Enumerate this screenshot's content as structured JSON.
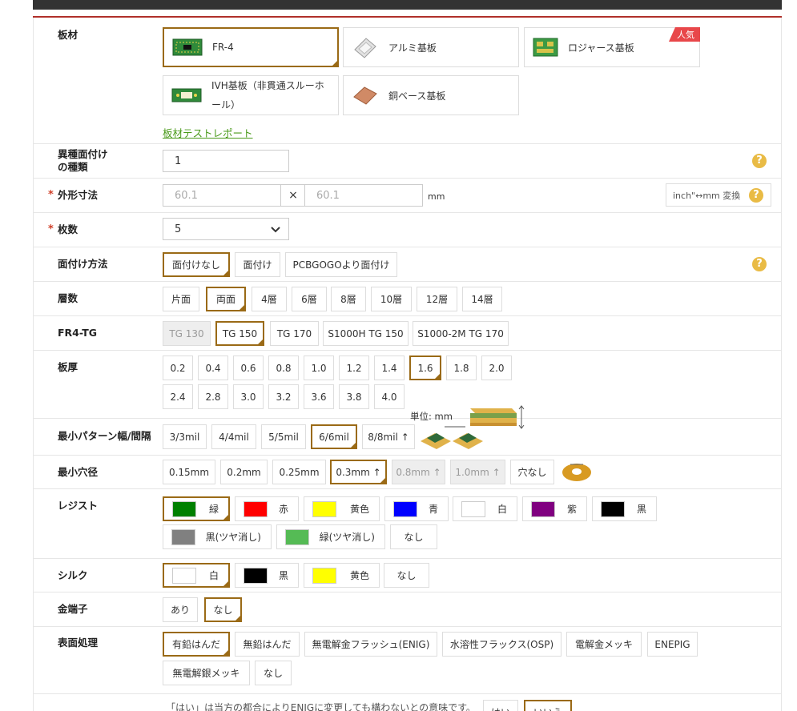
{
  "materials": {
    "label": "板材",
    "options": [
      {
        "label": "FR-4",
        "selected": true
      },
      {
        "label": "アルミ基板",
        "selected": false
      },
      {
        "label": "ロジャース基板",
        "selected": false,
        "badge": "人気"
      },
      {
        "label_line1": "IVH基板（非貫通スルーホ",
        "label_line2": "ール）",
        "selected": false
      },
      {
        "label": "銅ベース基板",
        "selected": false
      }
    ],
    "report_link": "板材テストレポート"
  },
  "variety": {
    "label_line1": "異種面付け",
    "label_line2": "の種類",
    "value": "1"
  },
  "size": {
    "label": "外形寸法",
    "width_placeholder": "60.1",
    "height_placeholder": "60.1",
    "times": "×",
    "unit": "mm",
    "convert_label": "inch\"↔mm 変換"
  },
  "quantity": {
    "label": "枚数",
    "value": "5"
  },
  "panelize": {
    "label": "面付け方法",
    "options": [
      "面付けなし",
      "面付け",
      "PCBGOGOより面付け"
    ],
    "selected": 0
  },
  "layers": {
    "label": "層数",
    "options": [
      "片面",
      "両面",
      "4層",
      "6層",
      "8層",
      "10層",
      "12層",
      "14層"
    ],
    "selected": 1
  },
  "tg": {
    "label": "FR4-TG",
    "options": [
      "TG 130",
      "TG 150",
      "TG 170",
      "S1000H TG 150",
      "S1000-2M TG 170"
    ],
    "selected": 1,
    "disabled": [
      0
    ]
  },
  "thickness": {
    "label": "板厚",
    "row1": [
      "0.2",
      "0.4",
      "0.6",
      "0.8",
      "1.0",
      "1.2",
      "1.4",
      "1.6",
      "1.8",
      "2.0"
    ],
    "row2": [
      "2.4",
      "2.8",
      "3.0",
      "3.2",
      "3.6",
      "3.8",
      "4.0"
    ],
    "selected": "1.6",
    "unit": "単位: mm"
  },
  "trace": {
    "label": "最小パターン幅/間隔",
    "options": [
      "3/3mil",
      "4/4mil",
      "5/5mil",
      "6/6mil",
      "8/8mil ↑"
    ],
    "selected": 3
  },
  "hole": {
    "label": "最小穴径",
    "options": [
      "0.15mm",
      "0.2mm",
      "0.25mm",
      "0.3mm ↑",
      "0.8mm ↑",
      "1.0mm ↑",
      "穴なし"
    ],
    "selected": 3,
    "disabled": [
      4,
      5
    ]
  },
  "resist": {
    "label": "レジスト",
    "options": [
      {
        "label": "緑",
        "color": "#008000"
      },
      {
        "label": "赤",
        "color": "#ff0000"
      },
      {
        "label": "黄色",
        "color": "#ffff00"
      },
      {
        "label": "青",
        "color": "#0000ff"
      },
      {
        "label": "白",
        "color": "#ffffff"
      },
      {
        "label": "紫",
        "color": "#800080"
      },
      {
        "label": "黒",
        "color": "#000000"
      },
      {
        "label": "黒(ツヤ消し)",
        "color": "#808080"
      },
      {
        "label": "緑(ツヤ消し)",
        "color": "#55bb55"
      },
      {
        "label": "なし",
        "color": ""
      }
    ],
    "selected": 0
  },
  "silk": {
    "label": "シルク",
    "options": [
      {
        "label": "白",
        "color": "#ffffff"
      },
      {
        "label": "黒",
        "color": "#000000"
      },
      {
        "label": "黄色",
        "color": "#ffff00"
      },
      {
        "label": "なし",
        "color": ""
      }
    ],
    "selected": 0
  },
  "gold_finger": {
    "label": "金端子",
    "options": [
      "あり",
      "なし"
    ],
    "selected": 1
  },
  "finish": {
    "label": "表面処理",
    "options": [
      "有鉛はんだ",
      "無鉛はんだ",
      "無電解金フラッシュ(ENIG)",
      "水溶性フラックス(OSP)",
      "電解金メッキ",
      "ENEPIG",
      "無電解銀メッキ",
      "なし"
    ],
    "selected": 0
  },
  "note": {
    "text": "「はい」は当方の都合によりENIGに変更しても構わないとの意味です。",
    "yes": "はい",
    "no": "いいえ"
  },
  "colors": {
    "accent": "#9a6a16",
    "required": "#d0402a",
    "link": "#4a9a1a",
    "help": "#e9bb45",
    "badge": "#e8474a"
  }
}
